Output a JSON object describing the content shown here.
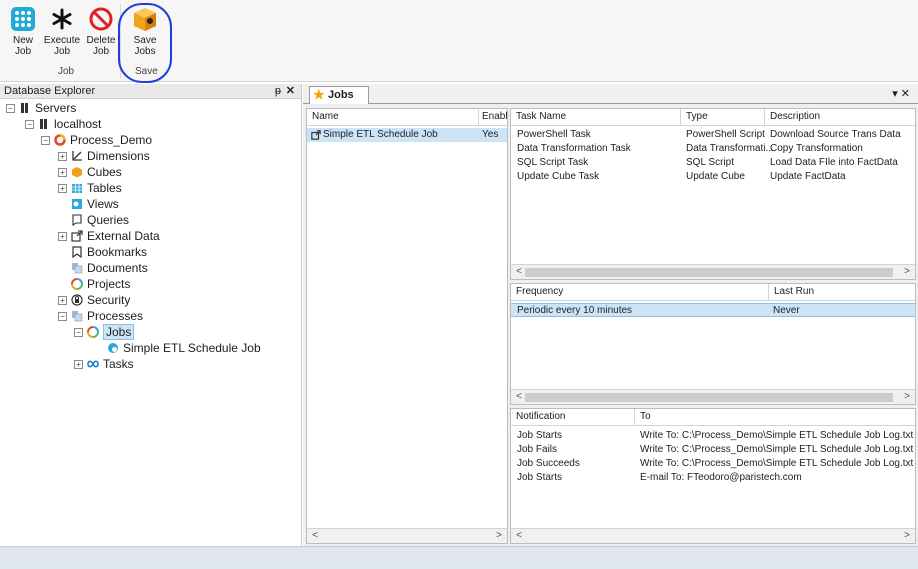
{
  "ribbon": {
    "new_job": "New\nJob",
    "execute_job": "Execute\nJob",
    "delete_job": "Delete\nJob",
    "save_jobs": "Save\nJobs",
    "group_job": "Job",
    "group_save": "Save"
  },
  "explorer": {
    "title": "Database Explorer",
    "pin": " ",
    "close": "✕",
    "tree": {
      "servers": "Servers",
      "localhost": "localhost",
      "process_demo": "Process_Demo",
      "dimensions": "Dimensions",
      "cubes": "Cubes",
      "tables": "Tables",
      "views": "Views",
      "queries": "Queries",
      "external_data": "External Data",
      "bookmarks": "Bookmarks",
      "documents": "Documents",
      "projects": "Projects",
      "security": "Security",
      "processes": "Processes",
      "jobs": "Jobs",
      "simple_etl": "Simple ETL Schedule  Job",
      "tasks": "Tasks"
    }
  },
  "tabs": {
    "jobs": "Jobs",
    "menu": "▾ ✕"
  },
  "jobs_list": {
    "headers": [
      "Name",
      "Enabl"
    ],
    "rows": [
      {
        "name": "Simple ETL Schedule  Job",
        "enabled": "Yes"
      }
    ]
  },
  "tasks": {
    "headers": [
      "Task Name",
      "Type",
      "Description"
    ],
    "rows": [
      {
        "name": "PowerShell Task",
        "type": "PowerShell Script",
        "desc": "Download Source Trans Data"
      },
      {
        "name": "Data Transformation Task",
        "type": "Data Transformati...",
        "desc": "Copy Transformation"
      },
      {
        "name": "SQL Script Task",
        "type": "SQL Script",
        "desc": "Load Data FIle into FactData"
      },
      {
        "name": "Update Cube Task",
        "type": "Update Cube",
        "desc": "Update FactData"
      }
    ]
  },
  "schedule": {
    "headers": [
      "Frequency",
      "Last Run"
    ],
    "rows": [
      {
        "frequency": "Periodic every 10 minutes",
        "last_run": "Never"
      }
    ]
  },
  "notifications": {
    "headers": [
      "Notification",
      "To"
    ],
    "rows": [
      {
        "event": "Job Starts",
        "to": "Write To: C:\\Process_Demo\\Simple ETL Schedule  Job Log.txt"
      },
      {
        "event": "Job Fails",
        "to": "Write To: C:\\Process_Demo\\Simple ETL Schedule  Job Log.txt"
      },
      {
        "event": "Job Succeeds",
        "to": "Write To: C:\\Process_Demo\\Simple ETL Schedule  Job Log.txt"
      },
      {
        "event": "Job Starts",
        "to": "E-mail To: FTeodoro@paristech.com"
      }
    ]
  },
  "scroll": {
    "left": "<",
    "right": ">"
  },
  "colors": {
    "selection": "#cde4f7",
    "ring": "#1f3fd6",
    "statusbar": "#dfe6ee"
  }
}
